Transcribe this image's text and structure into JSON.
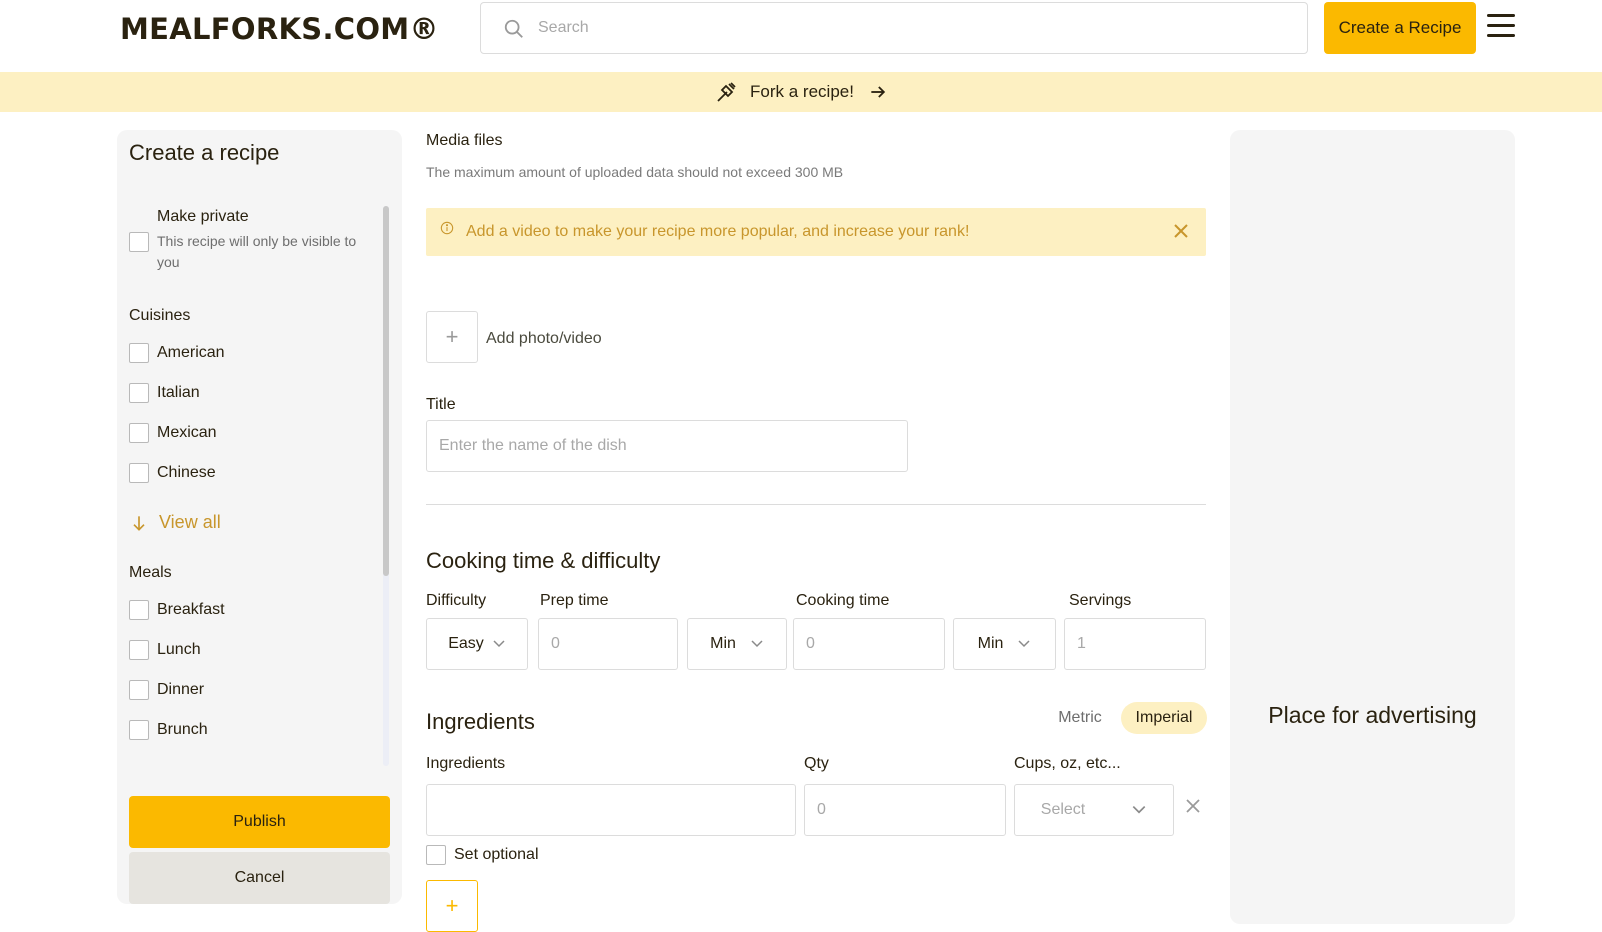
{
  "header": {
    "logo": "MEALFORKS.COM®",
    "search_placeholder": "Search",
    "create_button": "Create a Recipe"
  },
  "banner": {
    "text": "Fork a recipe!"
  },
  "sidebar": {
    "title": "Create a recipe",
    "private": {
      "label": "Make private",
      "description": "This recipe will only be visible to you"
    },
    "cuisines": {
      "title": "Cuisines",
      "items": [
        "American",
        "Italian",
        "Mexican",
        "Chinese"
      ],
      "view_all": "View all"
    },
    "meals": {
      "title": "Meals",
      "items": [
        "Breakfast",
        "Lunch",
        "Dinner",
        "Brunch"
      ]
    },
    "publish_button": "Publish",
    "cancel_button": "Cancel"
  },
  "media": {
    "title": "Media files",
    "limit_text": "The maximum amount of uploaded data should not exceed 300 MB",
    "alert": "Add a video to make your recipe more popular, and increase your rank!",
    "add_label": "Add photo/video"
  },
  "title_field": {
    "label": "Title",
    "placeholder": "Enter the name of the dish"
  },
  "cooking": {
    "heading": "Cooking time & difficulty",
    "difficulty_label": "Difficulty",
    "difficulty_value": "Easy",
    "prep_label": "Prep time",
    "prep_placeholder": "0",
    "prep_unit": "Min",
    "cook_label": "Cooking time",
    "cook_placeholder": "0",
    "cook_unit": "Min",
    "servings_label": "Servings",
    "servings_placeholder": "1"
  },
  "ingredients": {
    "heading": "Ingredients",
    "unit_metric": "Metric",
    "unit_imperial": "Imperial",
    "col_ingredients": "Ingredients",
    "col_qty": "Qty",
    "col_unit": "Cups, oz, etc...",
    "qty_placeholder": "0",
    "unit_placeholder": "Select",
    "optional_label": "Set optional"
  },
  "ad": {
    "text": "Place for advertising"
  },
  "colors": {
    "accent": "#fbb900",
    "banner": "#fdf0c2",
    "link": "#c8962c"
  }
}
